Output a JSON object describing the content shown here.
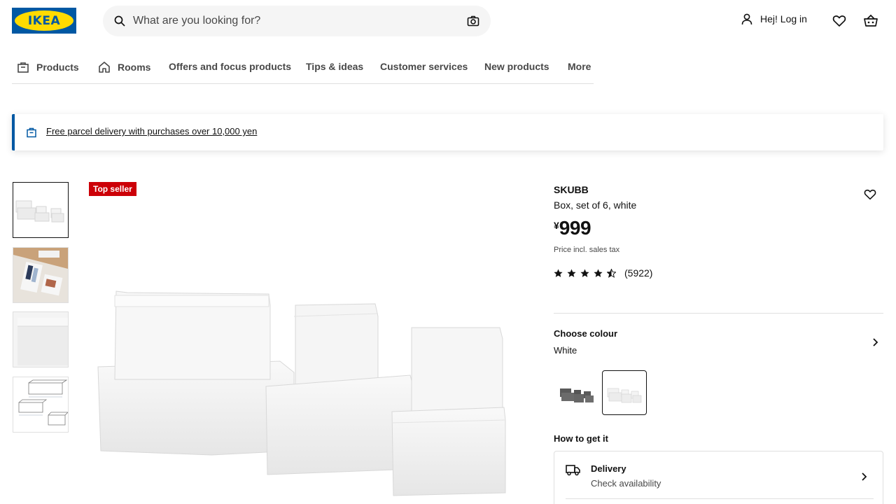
{
  "header": {
    "logo_text": "IKEA",
    "search_placeholder": "What are you looking for?",
    "login_label": "Hej! Log in"
  },
  "nav": {
    "items": [
      {
        "label": "Products",
        "icon": "shopping-bag-icon"
      },
      {
        "label": "Rooms",
        "icon": "house-icon"
      },
      {
        "label": "Offers and focus products"
      },
      {
        "label": "Tips & ideas"
      },
      {
        "label": "Customer services"
      },
      {
        "label": "New products"
      },
      {
        "label": "More"
      }
    ]
  },
  "banner": {
    "text": "Free parcel delivery with purchases over 10,000 yen"
  },
  "product": {
    "badge": "Top seller",
    "name": "SKUBB",
    "description": "Box, set of 6, white",
    "currency": "¥",
    "price": "999",
    "price_note": "Price incl. sales tax",
    "rating": 4.5,
    "review_count": "(5922)"
  },
  "colour": {
    "title": "Choose colour",
    "selected": "White",
    "options": [
      "Dark grey",
      "White"
    ]
  },
  "fulfilment": {
    "title": "How to get it",
    "delivery_title": "Delivery",
    "delivery_sub": "Check availability"
  },
  "colors": {
    "brand_blue": "#0058a3",
    "brand_yellow": "#ffdb00",
    "badge_red": "#cc0008"
  }
}
